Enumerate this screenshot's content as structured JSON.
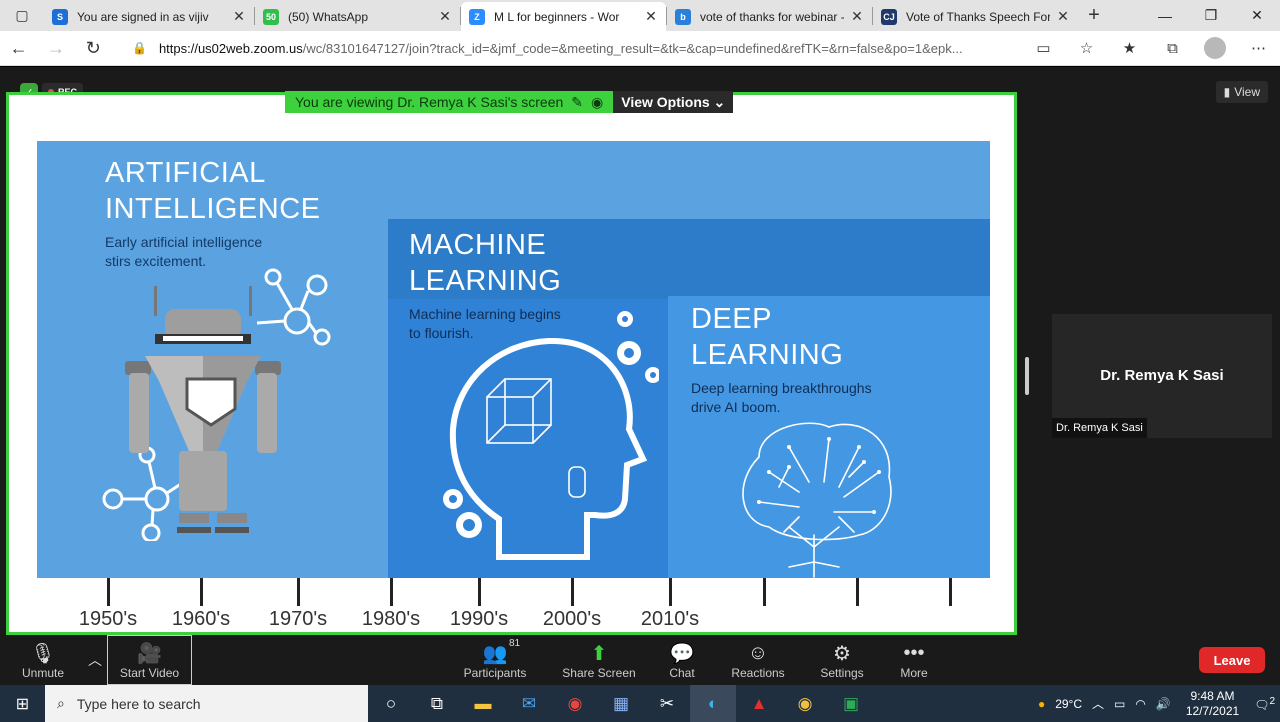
{
  "browser": {
    "tabs": [
      {
        "title": "You are signed in as vijiv",
        "favicon": "S",
        "color": "#1b6fd6"
      },
      {
        "title": "(50) WhatsApp",
        "favicon": "50",
        "color": "#2fbf4a"
      },
      {
        "title": "M L for beginners - Wor",
        "favicon": "Z",
        "color": "#2d8cff",
        "active": true
      },
      {
        "title": "vote of thanks for webinar - E",
        "favicon": "b",
        "color": "#2a80d8"
      },
      {
        "title": "Vote of Thanks Speech For G",
        "favicon": "CJ",
        "color": "#1d3a6b"
      }
    ],
    "url_host": "https://us02web.zoom.us",
    "url_path": "/wc/83101647127/join?track_id=&jmf_code=&meeting_result=&tk=&cap=undefined&refTK=&rn=false&po=1&epk..."
  },
  "meeting": {
    "rec_label": "REC",
    "viewing_text": "You are viewing Dr. Remya K Sasi's screen",
    "view_options": "View Options",
    "view_button": "View",
    "participant_name": "Dr. Remya K Sasi",
    "participant_label": "Dr. Remya K Sasi"
  },
  "slide": {
    "ai_title_1": "ARTIFICIAL",
    "ai_title_2": "INTELLIGENCE",
    "ai_sub_1": "Early artificial intelligence",
    "ai_sub_2": "stirs excitement.",
    "ml_title_1": "MACHINE",
    "ml_title_2": "LEARNING",
    "ml_sub_1": "Machine learning begins",
    "ml_sub_2": "to flourish.",
    "dl_title_1": "DEEP",
    "dl_title_2": "LEARNING",
    "dl_sub_1": "Deep learning breakthroughs",
    "dl_sub_2": "drive AI boom.",
    "decades": [
      "1950's",
      "1960's",
      "1970's",
      "1980's",
      "1990's",
      "2000's",
      "2010's"
    ]
  },
  "toolbar": {
    "unmute": "Unmute",
    "start_video": "Start Video",
    "participants": "Participants",
    "participants_count": "81",
    "share_screen": "Share Screen",
    "chat": "Chat",
    "reactions": "Reactions",
    "settings": "Settings",
    "more": "More",
    "leave": "Leave"
  },
  "taskbar": {
    "search_placeholder": "Type here to search",
    "temperature": "29°C",
    "time": "9:48 AM",
    "date": "12/7/2021",
    "notification_count": "2"
  }
}
